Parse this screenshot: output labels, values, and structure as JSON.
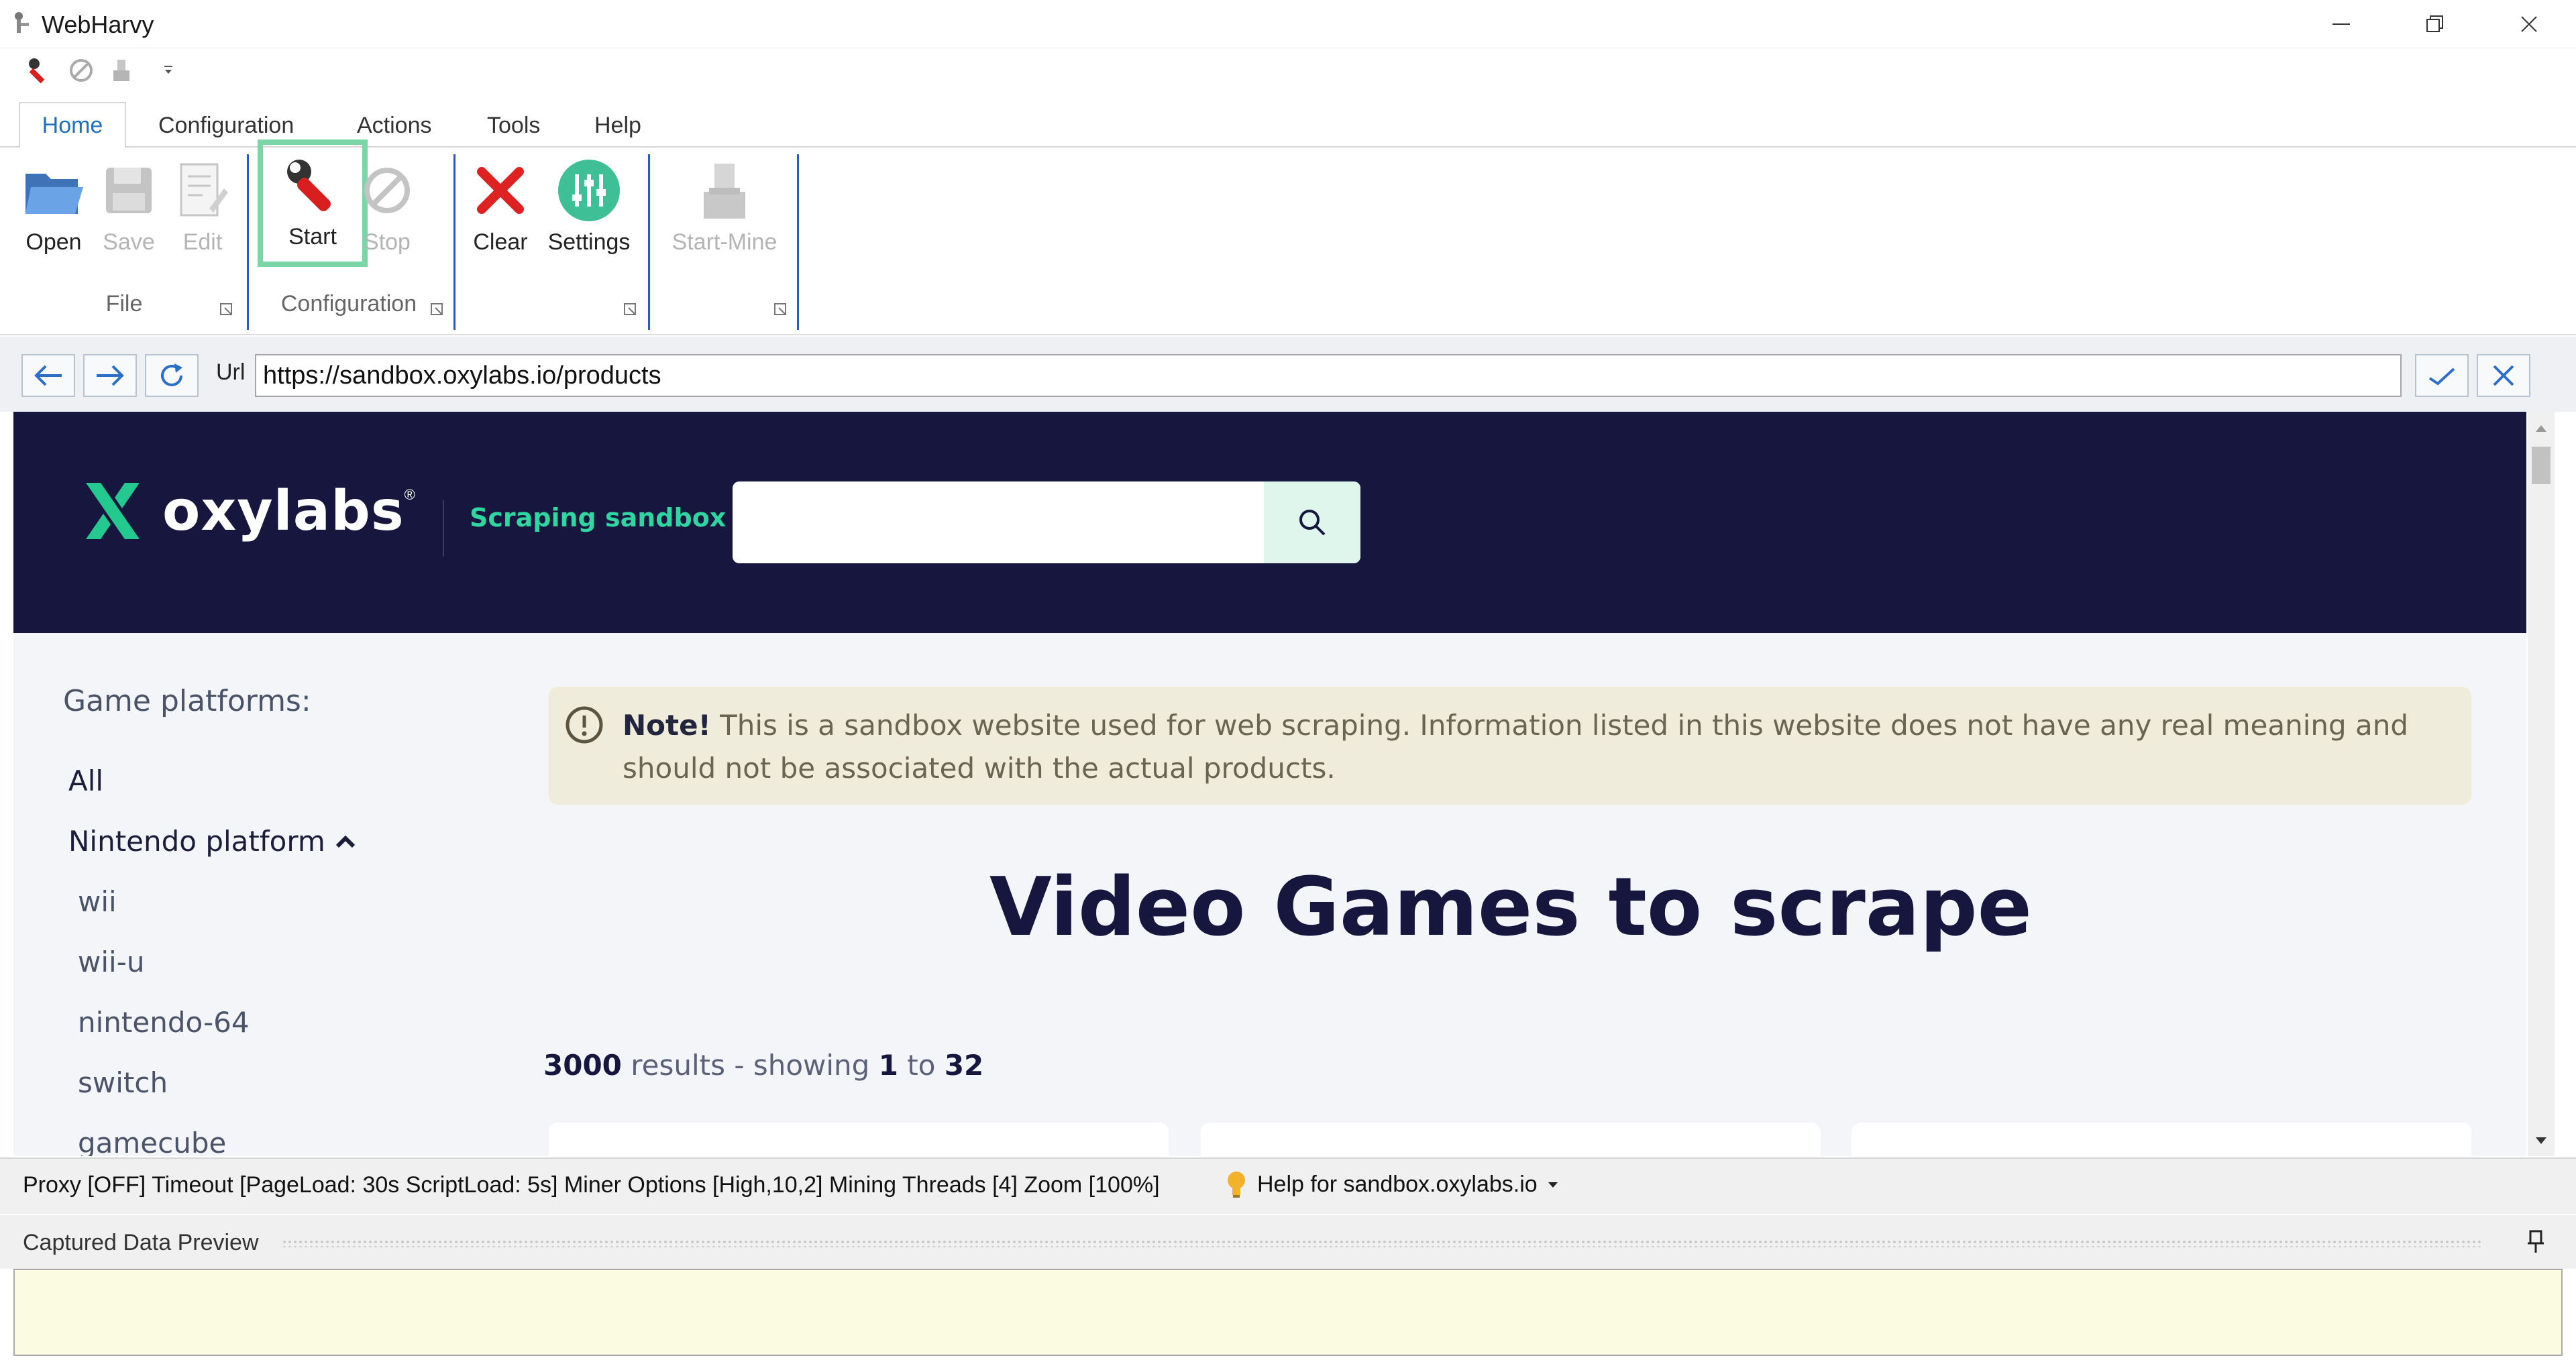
{
  "window": {
    "title": "WebHarvy"
  },
  "ribbon": {
    "tabs": [
      "Home",
      "Configuration",
      "Actions",
      "Tools",
      "Help"
    ],
    "active_tab": "Home",
    "buttons": {
      "open": "Open",
      "save": "Save",
      "edit": "Edit",
      "start": "Start",
      "stop": "Stop",
      "clear": "Clear",
      "settings": "Settings",
      "start_mine": "Start-Mine"
    },
    "groups": {
      "file": "File",
      "configuration": "Configuration"
    }
  },
  "address_bar": {
    "label": "Url",
    "url": "https://sandbox.oxylabs.io/products"
  },
  "site": {
    "logo_text": "oxylabs",
    "logo_reg": "®",
    "tagline": "Scraping sandbox",
    "sidebar": {
      "heading": "Game platforms:",
      "all": "All",
      "group": "Nintendo platform",
      "items": [
        "wii",
        "wii-u",
        "nintendo-64",
        "switch",
        "gamecube"
      ]
    },
    "note": {
      "bold": "Note!",
      "text": "This is a sandbox website used for web scraping. Information listed in this website does not have any real meaning and should not be associated with the actual products."
    },
    "heading": "Video Games to scrape",
    "results": {
      "total": "3000",
      "label_results": "results - showing",
      "from": "1",
      "label_to": "to",
      "to": "32"
    }
  },
  "status_bar": {
    "text": "Proxy [OFF] Timeout [PageLoad: 30s ScriptLoad: 5s] Miner Options [High,10,2] Mining Threads [4] Zoom [100%]",
    "help": "Help for sandbox.oxylabs.io"
  },
  "preview": {
    "title": "Captured Data Preview"
  },
  "colors": {
    "site_header": "#16163f",
    "accent_green": "#2fd6a0",
    "highlight": "#7ad6a7",
    "preview_bg": "#fafbe1"
  }
}
